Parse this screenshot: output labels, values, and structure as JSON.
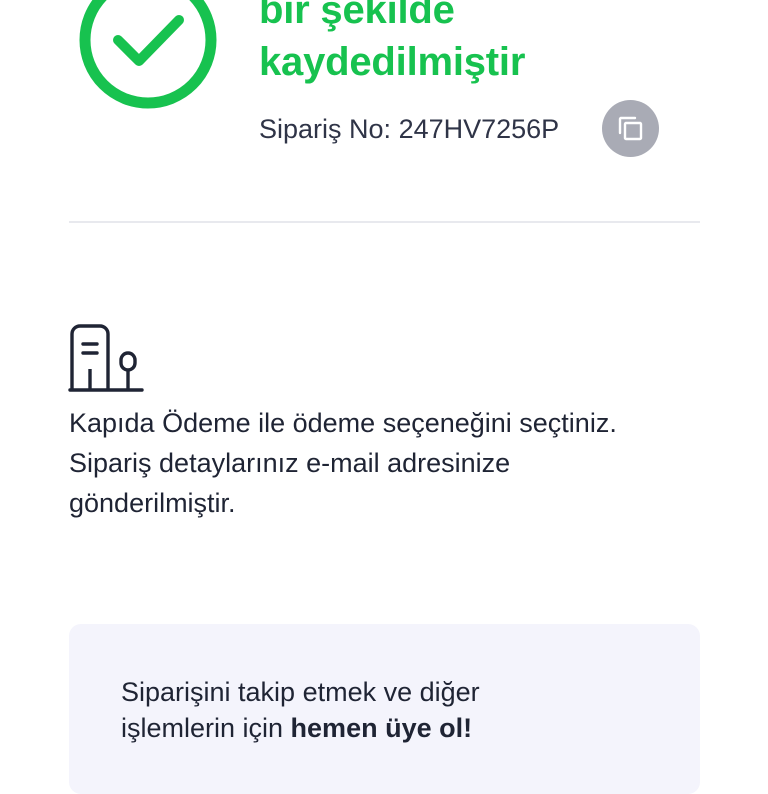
{
  "success": {
    "icon": "check-circle-icon",
    "title_line_1": "bir şekilde",
    "title_line_2": "kaydedilmiştir",
    "accent_color": "#17C24F"
  },
  "order": {
    "label": "Sipariş No:",
    "number": "247HV7256P",
    "copy_icon": "copy-icon"
  },
  "payment": {
    "icon": "door-payment-icon",
    "message_line_1": "Kapıda Ödeme ile ödeme seçeneğini seçtiniz.",
    "message_line_2": "Sipariş detaylarınız e-mail adresinize",
    "message_line_3": "gönderilmiştir."
  },
  "signup": {
    "line_1": "Siparişini takip etmek ve diğer",
    "line_2_prefix": "işlemlerin için ",
    "line_2_bold": "hemen üye ol!",
    "background_color": "#F4F4FC"
  }
}
